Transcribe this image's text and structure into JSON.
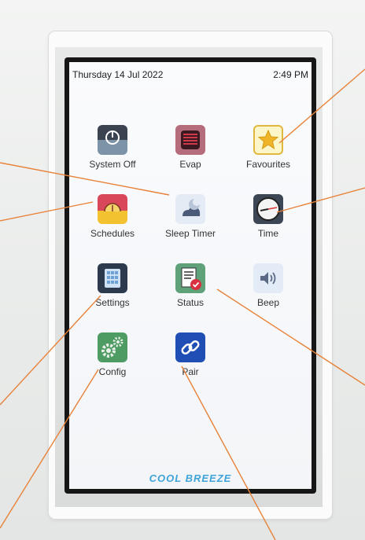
{
  "status_bar": {
    "date": "Thursday 14 Jul 2022",
    "time": "2:49 PM"
  },
  "tiles": [
    {
      "label": "System Off",
      "icon": "power-icon"
    },
    {
      "label": "Evap",
      "icon": "evap-icon"
    },
    {
      "label": "Favourites",
      "icon": "star-icon"
    },
    {
      "label": "Schedules",
      "icon": "schedule-icon"
    },
    {
      "label": "Sleep Timer",
      "icon": "moon-icon"
    },
    {
      "label": "Time",
      "icon": "clock-icon"
    },
    {
      "label": "Settings",
      "icon": "settings-icon"
    },
    {
      "label": "Status",
      "icon": "status-icon"
    },
    {
      "label": "Beep",
      "icon": "speaker-icon"
    },
    {
      "label": "Config",
      "icon": "gears-icon"
    },
    {
      "label": "Pair",
      "icon": "link-icon"
    }
  ],
  "brand": {
    "logo_text": "COOL BREEZE",
    "accent": "#3fa3d8",
    "callout_color": "#e8823a"
  }
}
